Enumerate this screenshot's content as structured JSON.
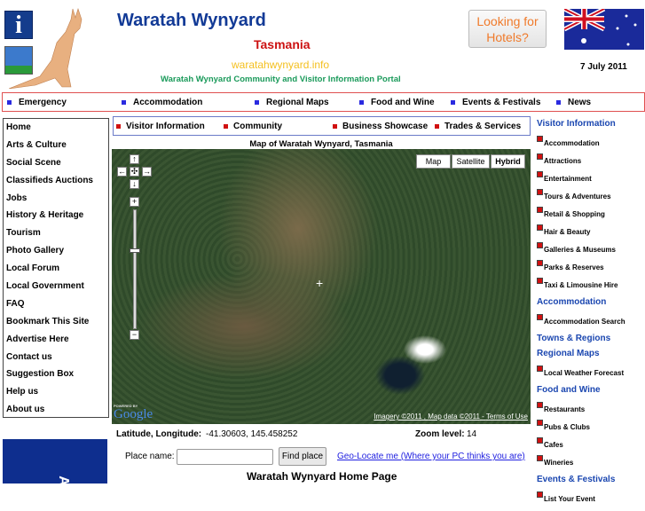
{
  "header": {
    "title": "Waratah Wynyard",
    "state": "Tasmania",
    "domain": "waratahwynyard.info",
    "tagline": "Waratah Wynyard Community and Visitor Information Portal",
    "hotels_button": "Looking for Hotels?",
    "date": "7 July 2011",
    "info_icon_letter": "i"
  },
  "top_nav": [
    "Emergency",
    "Accommodation",
    "Regional Maps",
    "Food and Wine",
    "Events & Festivals",
    "News"
  ],
  "sub_nav": [
    "Visitor Information",
    "Community",
    "Business Showcase",
    "Trades & Services"
  ],
  "left_nav": [
    "Home",
    "Arts & Culture",
    "Social Scene",
    "Classifieds Auctions",
    "Jobs",
    "History & Heritage",
    "Tourism",
    "Photo Gallery",
    "Local Forum",
    "Local Government",
    "FAQ",
    "Bookmark This Site",
    "Advertise Here",
    "Contact us",
    "Suggestion Box",
    "Help us",
    "About us"
  ],
  "map": {
    "title": "Map of Waratah Wynyard, Tasmania",
    "types": [
      "Map",
      "Satellite",
      "Hybrid"
    ],
    "selected_type": "Hybrid",
    "attribution": [
      "Imagery ©2011",
      "Map data ©2011",
      "Terms of Use"
    ],
    "logo": "Google",
    "powered_by": "POWERED BY"
  },
  "coords": {
    "label": "Latitude, Longitude:",
    "value": "-41.30603, 145.458252",
    "zoom_label": "Zoom level:",
    "zoom_value": "14"
  },
  "search": {
    "label": "Place name:",
    "value": "",
    "button": "Find place",
    "geolocate": "Geo-Locate me (Where your PC thinks you are)"
  },
  "footer_title": "Waratah Wynyard Home Page",
  "banner_text": "A",
  "right_nav": [
    {
      "heading": "Visitor Information",
      "items": [
        "Accommodation",
        "Attractions",
        "Entertainment",
        "Tours & Adventures",
        "Retail & Shopping",
        "Hair & Beauty",
        "Galleries & Museums",
        "Parks & Reserves",
        "Taxi & Limousine Hire"
      ]
    },
    {
      "heading": "Accommodation",
      "items": [
        "Accommodation Search"
      ]
    },
    {
      "heading": "Towns & Regions",
      "items": []
    },
    {
      "heading": "Regional Maps",
      "items": [
        "Local Weather Forecast"
      ]
    },
    {
      "heading": "Food and Wine",
      "items": [
        "Restaurants",
        "Pubs & Clubs",
        "Cafes",
        "Wineries"
      ]
    },
    {
      "heading": "Events & Festivals",
      "items": [
        "List Your Event"
      ]
    }
  ]
}
